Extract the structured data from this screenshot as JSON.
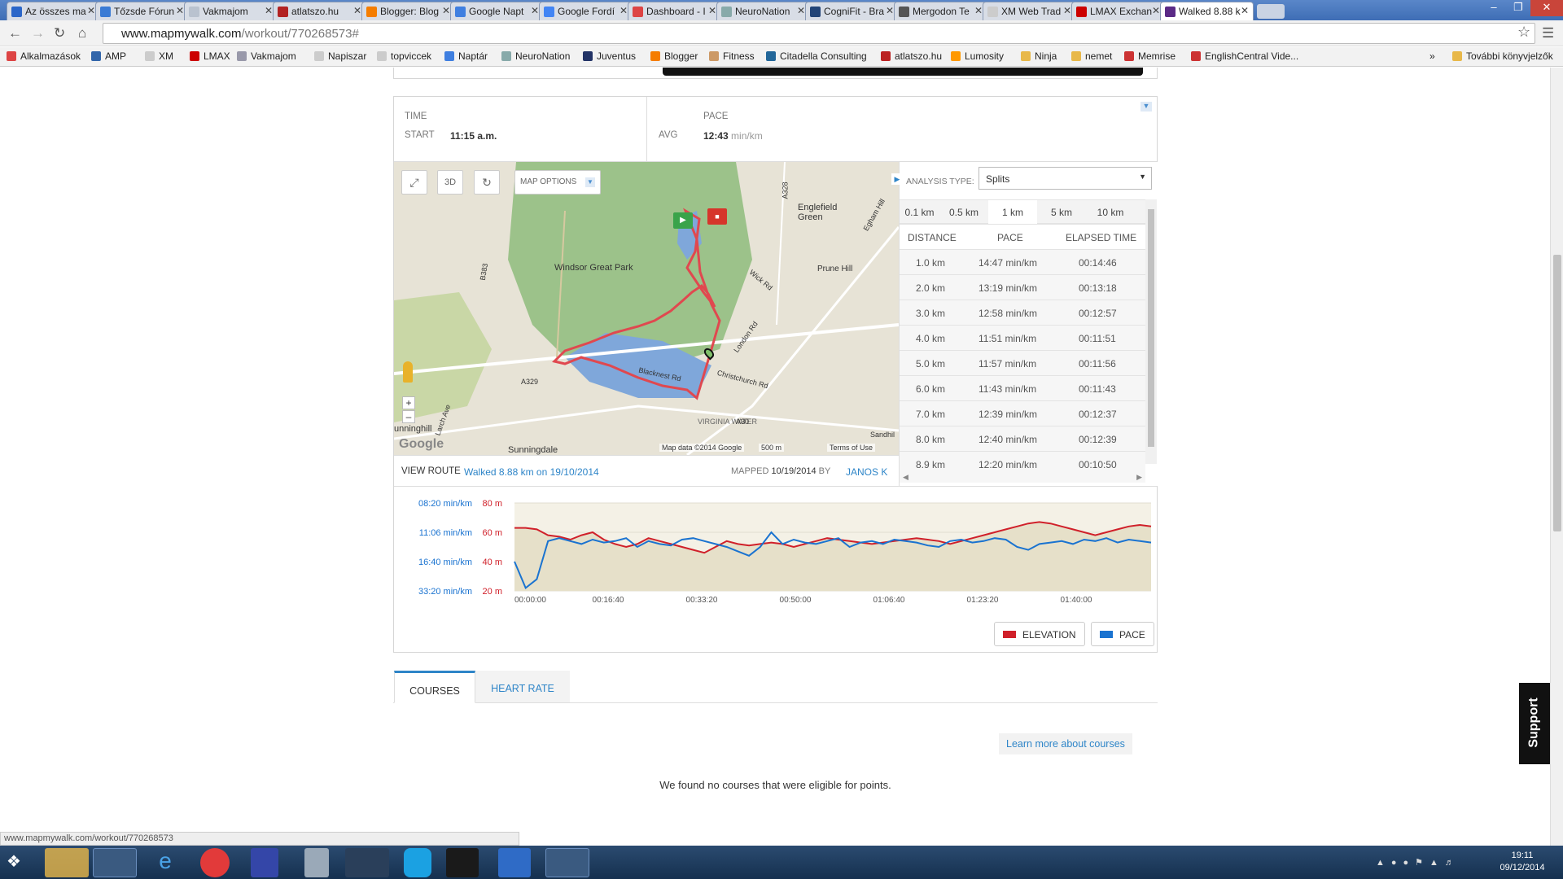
{
  "browser": {
    "tabs": [
      {
        "label": "Az összes ma",
        "color": "#2a66c9"
      },
      {
        "label": "Tőzsde Fórun",
        "color": "#3a7bd5"
      },
      {
        "label": "Vakmajom",
        "color": "#b9c2cf"
      },
      {
        "label": "atlatszo.hu",
        "color": "#b22222"
      },
      {
        "label": "Blogger: Blog",
        "color": "#f57d00"
      },
      {
        "label": "Google Napt",
        "color": "#3f7fe0"
      },
      {
        "label": "Google Fordí",
        "color": "#4285f4"
      },
      {
        "label": "Dashboard - I",
        "color": "#d44"
      },
      {
        "label": "NeuroNation",
        "color": "#8aa"
      },
      {
        "label": "CogniFit - Bra",
        "color": "#247"
      },
      {
        "label": "Mergodon Te",
        "color": "#555"
      },
      {
        "label": "XM Web Trad",
        "color": "#ccc"
      },
      {
        "label": "LMAX Exchan",
        "color": "#c00"
      },
      {
        "label": "Walked 8.88 k",
        "color": "#5b2a86"
      }
    ],
    "url_main": "www.mapmywalk.com",
    "url_path": "/workout/770268573#",
    "bookmarks": [
      {
        "label": "Alkalmazások",
        "color": "#d44"
      },
      {
        "label": "AMP",
        "color": "#36a"
      },
      {
        "label": "XM",
        "color": "#ccc"
      },
      {
        "label": "LMAX",
        "color": "#c00"
      },
      {
        "label": "Vakmajom",
        "color": "#99a"
      },
      {
        "label": "Napiszar",
        "color": "#ccc"
      },
      {
        "label": "topviccek",
        "color": "#ccc"
      },
      {
        "label": "Naptár",
        "color": "#3f7fe0"
      },
      {
        "label": "NeuroNation",
        "color": "#8aa"
      },
      {
        "label": "Juventus",
        "color": "#236"
      },
      {
        "label": "Blogger",
        "color": "#f57d00"
      },
      {
        "label": "Fitness",
        "color": "#c96"
      },
      {
        "label": "Citadella Consulting",
        "color": "#269"
      },
      {
        "label": "atlatszo.hu",
        "color": "#b22"
      },
      {
        "label": "Lumosity",
        "color": "#f90"
      },
      {
        "label": "Ninja",
        "color": "#e8b84a"
      },
      {
        "label": "nemet",
        "color": "#e8b84a"
      },
      {
        "label": "Memrise",
        "color": "#c33"
      },
      {
        "label": "EnglishCentral Vide...",
        "color": "#c33"
      }
    ],
    "more_bookmarks": "További könyvjelzők",
    "status_url": "www.mapmywalk.com/workout/770268573"
  },
  "stats": {
    "time_label": "TIME",
    "start_label": "START",
    "start_value": "11:15 a.m.",
    "pace_label": "PACE",
    "avg_label": "AVG",
    "avg_value": "12:43",
    "avg_unit": "min/km"
  },
  "map": {
    "map_options": "MAP OPTIONS",
    "btn_3d": "3D",
    "labels": {
      "park": "Windsor Great Park",
      "englefield": "Englefield Green",
      "virginia": "VIRGINIA WATER",
      "sunningdale": "Sunningdale",
      "sunninghill": "unninghill",
      "london_rd": "London Rd",
      "blacknest": "Blacknest Rd",
      "christchurch": "Christchurch Rd",
      "wick": "Wick Rd",
      "prune": "Prune Hill",
      "a329": "A329",
      "a30": "A30",
      "b383": "B383",
      "a328": "A328",
      "egham": "Egham Hill",
      "larch": "Larch Ave",
      "sandhill": "Sandhil",
      "google": "Google"
    },
    "attribution": "Map data ©2014 Google",
    "scale": "500 m",
    "terms": "Terms of Use"
  },
  "route_footer": {
    "view_route": "VIEW ROUTE",
    "route_link": "Walked 8.88 km on 19/10/2014",
    "mapped": "MAPPED",
    "mapped_date": "10/19/2014",
    "by": "BY",
    "author": "JANOS K"
  },
  "analysis": {
    "type_label": "ANALYSIS TYPE:",
    "type_value": "Splits",
    "segments": [
      "0.1 km",
      "0.5 km",
      "1 km",
      "5 km",
      "10 km"
    ],
    "active_segment": "1 km",
    "headers": [
      "DISTANCE",
      "PACE",
      "ELAPSED TIME"
    ],
    "rows": [
      [
        "1.0 km",
        "14:47 min/km",
        "00:14:46"
      ],
      [
        "2.0 km",
        "13:19 min/km",
        "00:13:18"
      ],
      [
        "3.0 km",
        "12:58 min/km",
        "00:12:57"
      ],
      [
        "4.0 km",
        "11:51 min/km",
        "00:11:51"
      ],
      [
        "5.0 km",
        "11:57 min/km",
        "00:11:56"
      ],
      [
        "6.0 km",
        "11:43 min/km",
        "00:11:43"
      ],
      [
        "7.0 km",
        "12:39 min/km",
        "00:12:37"
      ],
      [
        "8.0 km",
        "12:40 min/km",
        "00:12:39"
      ],
      [
        "8.9 km",
        "12:20 min/km",
        "00:10:50"
      ]
    ]
  },
  "chart_data": {
    "type": "line",
    "pace_ticks": [
      "08:20 min/km",
      "11:06 min/km",
      "16:40 min/km",
      "33:20 min/km"
    ],
    "elev_ticks": [
      "80 m",
      "60 m",
      "40 m",
      "20 m"
    ],
    "x_ticks": [
      "00:00:00",
      "00:16:40",
      "00:33:20",
      "00:50:00",
      "01:06:40",
      "01:23:20",
      "01:40:00"
    ],
    "series": [
      {
        "name": "ELEVATION",
        "color": "#d0202a",
        "values": [
          63,
          63,
          62,
          58,
          57,
          55,
          58,
          60,
          55,
          52,
          50,
          52,
          56,
          54,
          52,
          50,
          48,
          46,
          50,
          54,
          52,
          51,
          52,
          53,
          52,
          50,
          52,
          54,
          56,
          55,
          54,
          53,
          52,
          53,
          54,
          55,
          56,
          55,
          54,
          52,
          54,
          56,
          58,
          60,
          62,
          64,
          66,
          67,
          66,
          64,
          62,
          60,
          58,
          60,
          62,
          64,
          65,
          64
        ]
      },
      {
        "name": "PACE",
        "color": "#1a73d0",
        "values": [
          40,
          22,
          28,
          54,
          56,
          54,
          52,
          55,
          53,
          54,
          56,
          50,
          54,
          52,
          51,
          55,
          56,
          54,
          52,
          50,
          47,
          44,
          50,
          60,
          52,
          55,
          53,
          52,
          54,
          56,
          50,
          53,
          54,
          52,
          55,
          54,
          53,
          51,
          50,
          54,
          55,
          53,
          54,
          56,
          55,
          50,
          48,
          52,
          53,
          54,
          52,
          55,
          54,
          56,
          53,
          55,
          54,
          53
        ]
      }
    ],
    "legend": [
      "ELEVATION",
      "PACE"
    ]
  },
  "courses": {
    "tabs": [
      "COURSES",
      "HEART RATE"
    ],
    "learn_more": "Learn more about courses",
    "empty": "We found no courses that were eligible for points."
  },
  "support": "Support",
  "taskbar": {
    "time": "19:11",
    "date": "09/12/2014"
  }
}
